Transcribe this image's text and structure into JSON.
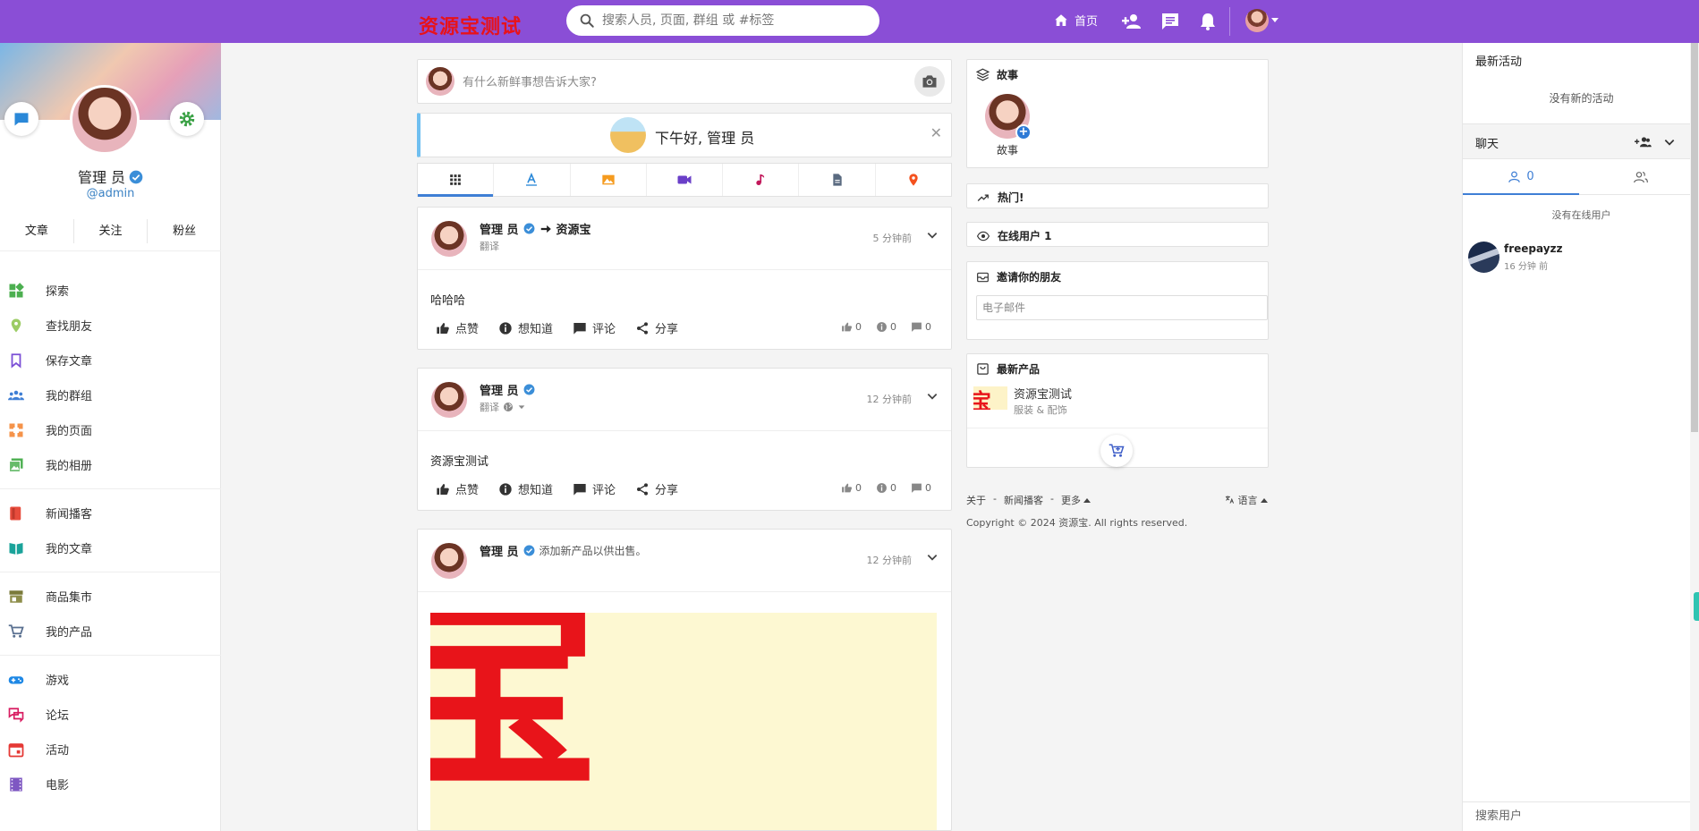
{
  "header": {
    "logo": "资源宝测试",
    "search_placeholder": "搜索人员, 页面, 群组 或 #标签",
    "home_label": "首页"
  },
  "profile": {
    "name": "管理 员",
    "handle": "@admin",
    "stats": [
      "文章",
      "关注",
      "粉丝"
    ]
  },
  "menu": {
    "group1": [
      "探索",
      "查找朋友",
      "保存文章",
      "我的群组",
      "我的页面",
      "我的相册"
    ],
    "group2": [
      "新闻播客",
      "我的文章"
    ],
    "group3": [
      "商品集市",
      "我的产品"
    ],
    "group4": [
      "游戏",
      "论坛",
      "活动",
      "电影"
    ]
  },
  "composer": {
    "placeholder": "有什么新鲜事想告诉大家?"
  },
  "greeting": "下午好, 管理 员",
  "posts": [
    {
      "author": "管理 员",
      "target": "资源宝",
      "sub": "翻译",
      "time": "5 分钟前",
      "text": "哈哈哈",
      "actions": [
        "点赞",
        "想知道",
        "评论",
        "分享"
      ],
      "counts": [
        "0",
        "0",
        "0"
      ]
    },
    {
      "author": "管理 员",
      "sub": "翻译",
      "time": "12 分钟前",
      "text": "资源宝测试",
      "actions": [
        "点赞",
        "想知道",
        "评论",
        "分享"
      ],
      "counts": [
        "0",
        "0",
        "0"
      ]
    },
    {
      "author": "管理 员",
      "note": "添加新产品以供出售。",
      "time": "12 分钟前",
      "image_text": "宝"
    }
  ],
  "widgets": {
    "stories_title": "故事",
    "story_label": "故事",
    "trending_title": "热门!",
    "online_title": "在线用户 1",
    "invite_title": "邀请你的朋友",
    "email_placeholder": "电子邮件",
    "products_title": "最新产品",
    "product_name": "资源宝测试",
    "product_category": "服装 & 配饰",
    "product_thumb_text": "宝",
    "footer_links": [
      "关于",
      "-",
      "新闻播客",
      "-",
      "更多"
    ],
    "language": "语言",
    "copyright": "Copyright © 2024 资源宝. All rights reserved."
  },
  "rightpanel": {
    "activity_title": "最新活动",
    "no_activity": "没有新的活动",
    "chat_title": "聊天",
    "online_count": "0",
    "no_online": "没有在线用户",
    "user_name": "freepayzz",
    "user_time": "16 分钟 前",
    "search_placeholder": "搜索用户"
  },
  "colors": {
    "topbar": "#8a4ed6",
    "logo": "#e8121a",
    "accent": "#3f7fd5"
  }
}
